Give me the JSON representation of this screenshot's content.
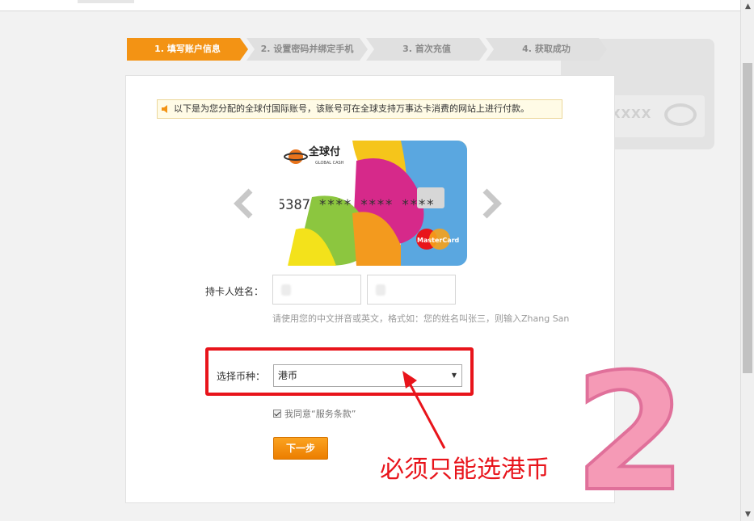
{
  "steps": [
    {
      "label": "1. 填写账户信息",
      "active": true
    },
    {
      "label": "2. 设置密码并绑定手机",
      "active": false
    },
    {
      "label": "3. 首次充值",
      "active": false
    },
    {
      "label": "4. 获取成功",
      "active": false
    }
  ],
  "ghost_card": {
    "text": "XXXX"
  },
  "notice": {
    "text": "以下是为您分配的全球付国际账号，该账号可在全球支持万事达卡消费的网站上进行付款。"
  },
  "card": {
    "brand": "全球付",
    "brand_sub": "GLOBAL CASH",
    "number": "5387 **** **** ****",
    "network": "MasterCard"
  },
  "form": {
    "name_label": "持卡人姓名：",
    "name_hint": "请使用您的中文拼音或英文，格式如：您的姓名叫张三，则输入Zhang San",
    "currency_label": "选择币种：",
    "currency_value": "港币",
    "agree_text": "我同意“服务条款”",
    "next_label": "下一步"
  },
  "annotation": {
    "text": "必须只能选港币",
    "number": "2"
  },
  "colors": {
    "accent": "#f39314",
    "highlight": "#e8141b",
    "step_inactive": "#e0e0e0"
  }
}
